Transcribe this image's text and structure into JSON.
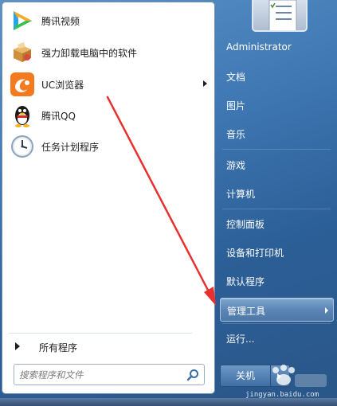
{
  "programs": [
    {
      "label": "腾讯视频",
      "icon": "tencent-video-icon"
    },
    {
      "label": "强力卸载电脑中的软件",
      "icon": "uninstaller-box-icon"
    },
    {
      "label": "UC浏览器",
      "icon": "uc-browser-icon",
      "has_submenu": true
    },
    {
      "label": "腾讯QQ",
      "icon": "qq-penguin-icon"
    },
    {
      "label": "任务计划程序",
      "icon": "task-scheduler-clock-icon"
    }
  ],
  "all_programs": {
    "label": "所有程序"
  },
  "search": {
    "placeholder": "搜索程序和文件",
    "icon": "search-icon"
  },
  "right_panel": {
    "user": "Administrator",
    "items": [
      {
        "label": "文档"
      },
      {
        "label": "图片"
      },
      {
        "label": "音乐"
      },
      {
        "label": "游戏"
      },
      {
        "label": "计算机"
      },
      {
        "label": "控制面板"
      },
      {
        "label": "设备和打印机"
      },
      {
        "label": "默认程序"
      },
      {
        "label": "管理工具",
        "has_submenu": true,
        "highlighted": true
      },
      {
        "label": "运行..."
      }
    ]
  },
  "shutdown": {
    "label": "关机"
  },
  "watermark": {
    "url": "jingyan.baidu.com"
  },
  "colors": {
    "annotation_arrow": "#e8312f",
    "highlight": "#5c86b5",
    "left_panel": "#ffffff",
    "right_panel": "#3f78b3"
  }
}
